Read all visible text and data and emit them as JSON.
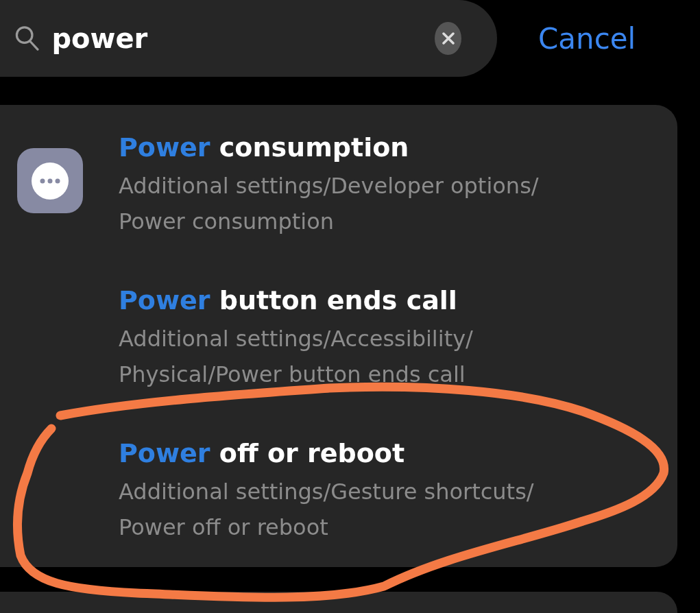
{
  "search": {
    "value": "power",
    "cancel": "Cancel"
  },
  "results": [
    {
      "match": "Power",
      "rest": " consumption",
      "path": [
        "Additional settings/Developer options/",
        "Power consumption"
      ],
      "has_icon": true
    },
    {
      "match": "Power",
      "rest": " button ends call",
      "path": [
        "Additional settings/Accessibility/",
        "Physical/Power button ends call"
      ],
      "has_icon": false
    },
    {
      "match": "Power",
      "rest": " off or reboot",
      "path": [
        "Additional settings/Gesture shortcuts/",
        "Power off or reboot"
      ],
      "has_icon": false
    }
  ]
}
